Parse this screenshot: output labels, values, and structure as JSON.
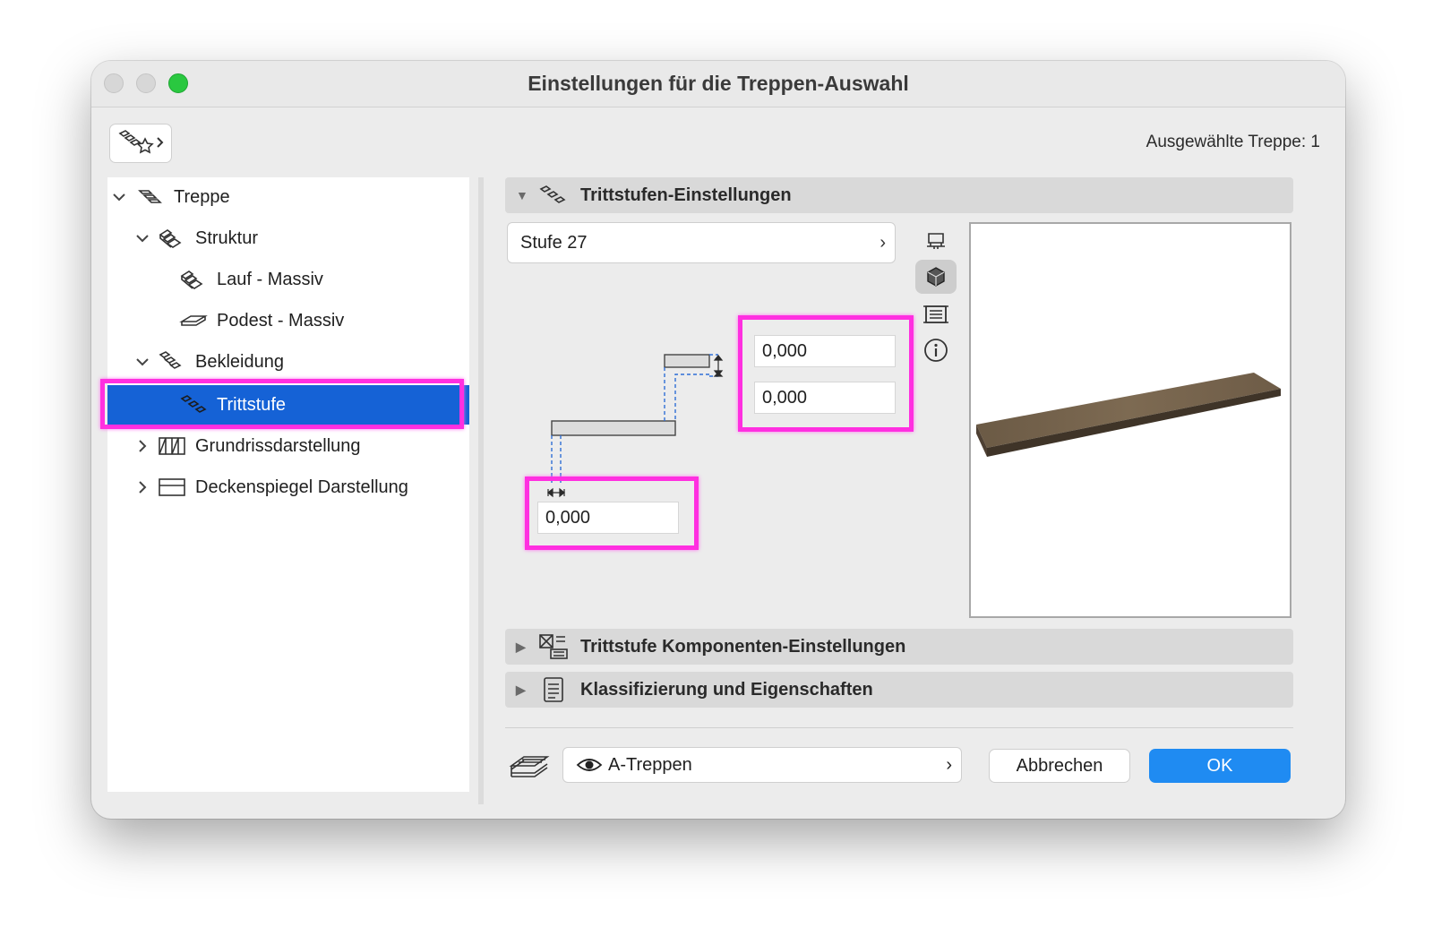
{
  "window": {
    "title": "Einstellungen für die Treppen-Auswahl",
    "selected_count": "Ausgewählte Treppe: 1"
  },
  "tree": {
    "items": [
      {
        "label": "Treppe",
        "icon": "stair-icon",
        "expanded": true
      },
      {
        "label": "Struktur",
        "icon": "structure-icon",
        "expanded": true
      },
      {
        "label": "Lauf - Massiv",
        "icon": "flight-icon"
      },
      {
        "label": "Podest - Massiv",
        "icon": "landing-icon"
      },
      {
        "label": "Bekleidung",
        "icon": "finish-icon",
        "expanded": true
      },
      {
        "label": "Trittstufe",
        "icon": "tread-icon",
        "selected": true
      },
      {
        "label": "Grundrissdarstellung",
        "icon": "floorplan-icon",
        "expanded": false
      },
      {
        "label": "Deckenspiegel Darstellung",
        "icon": "ceiling-icon",
        "expanded": false
      }
    ]
  },
  "tread_settings": {
    "header": "Trittstufen-Einstellungen",
    "stufe_select": "Stufe 27",
    "thickness_top": "0,000",
    "thickness_bottom": "0,000",
    "nosing": "0,000"
  },
  "sections": {
    "components": "Trittstufe Komponenten-Einstellungen",
    "classification": "Klassifizierung und Eigenschaften"
  },
  "footer": {
    "layer": "A-Treppen",
    "cancel_label": "Abbrechen",
    "ok_label": "OK"
  },
  "colors": {
    "accent": "#1f8bf2",
    "selection": "#1562d6",
    "highlight": "#ff2fe0"
  }
}
